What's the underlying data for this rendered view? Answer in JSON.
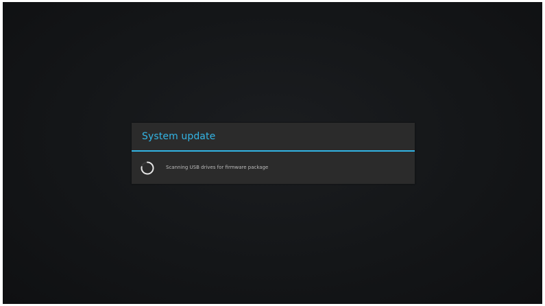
{
  "dialog": {
    "title": "System update",
    "message": "Scanning USB drives for firmware package"
  },
  "icons": {
    "spinner": "progress-spinner-icon"
  },
  "colors": {
    "accent": "#33b5e5",
    "background": "#141618",
    "dialog_background": "#2b2b2b",
    "message_text": "#bdbdbd"
  }
}
